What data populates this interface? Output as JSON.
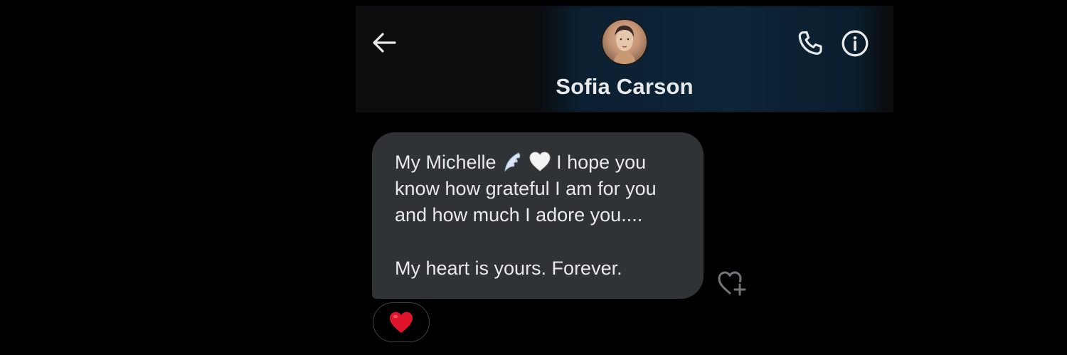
{
  "header": {
    "contact_name": "Sofia Carson",
    "icons": {
      "back": "arrow-left-icon",
      "call": "phone-icon",
      "info": "info-icon"
    }
  },
  "message": {
    "lines": [
      "My Michelle",
      "know how grateful I am for you",
      "and how much I adore you....",
      "My heart is yours. Forever."
    ],
    "line1_tail": "I hope you",
    "emojis": [
      "wing-emoji",
      "white-heart-emoji"
    ]
  },
  "reaction": {
    "emoji": "red-heart-emoji",
    "add_icon": "heart-plus-icon"
  },
  "colors": {
    "background": "#000000",
    "bubble": "#2f3336",
    "text": "#e7e9ea",
    "header_accent": "#0e2639",
    "heart": "#e0142b"
  }
}
